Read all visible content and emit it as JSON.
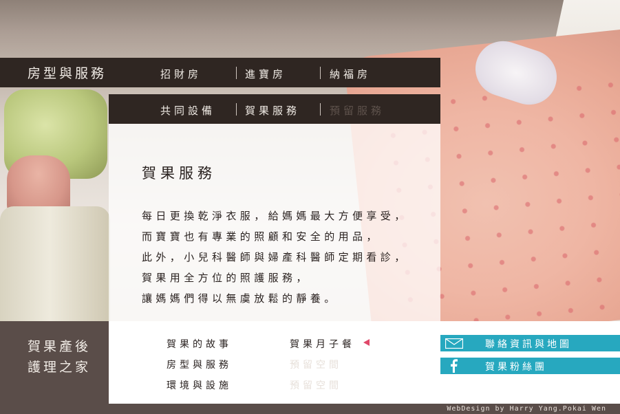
{
  "section": {
    "title": "房型與服務"
  },
  "nav": {
    "row1": [
      {
        "label": "招財房",
        "active": true
      },
      {
        "label": "進寶房",
        "active": true
      },
      {
        "label": "納福房",
        "active": true
      }
    ],
    "row2": [
      {
        "label": "共同設備",
        "active": true
      },
      {
        "label": "賀果服務",
        "active": true
      },
      {
        "label": "預留服務",
        "active": false
      }
    ]
  },
  "content": {
    "title": "賀果服務",
    "lines": [
      "每日更換乾淨衣服，給媽媽最大方便享受，",
      "而寶寶也有專業的照顧和安全的用品，",
      "此外，小兒科醫師與婦產科醫師定期看診，",
      "賀果用全方位的照護服務，",
      "讓媽媽們得以無虞放鬆的靜養。"
    ]
  },
  "logo": {
    "line1": "賀果產後",
    "line2": "護理之家"
  },
  "footer": {
    "col1": [
      "賀果的故事",
      "房型與服務",
      "環境與設施"
    ],
    "col2": [
      {
        "label": "賀果月子餐",
        "active": true
      },
      {
        "label": "預留空間",
        "active": false
      },
      {
        "label": "預留空間",
        "active": false
      }
    ],
    "buttons": {
      "contact": "聯絡資訊與地圖",
      "fans": "賀果粉絲團"
    },
    "credit": "WebDesign by Harry Yang.Pokai Wen"
  },
  "colors": {
    "nav_dark": "#2f2622",
    "logo_block": "#5a4d49",
    "accent_blue": "#27a8bf",
    "arrow_pink": "#e0496a"
  },
  "icons": {
    "arrow": "arrow-left-icon",
    "mail": "mail-icon",
    "facebook": "facebook-icon"
  }
}
